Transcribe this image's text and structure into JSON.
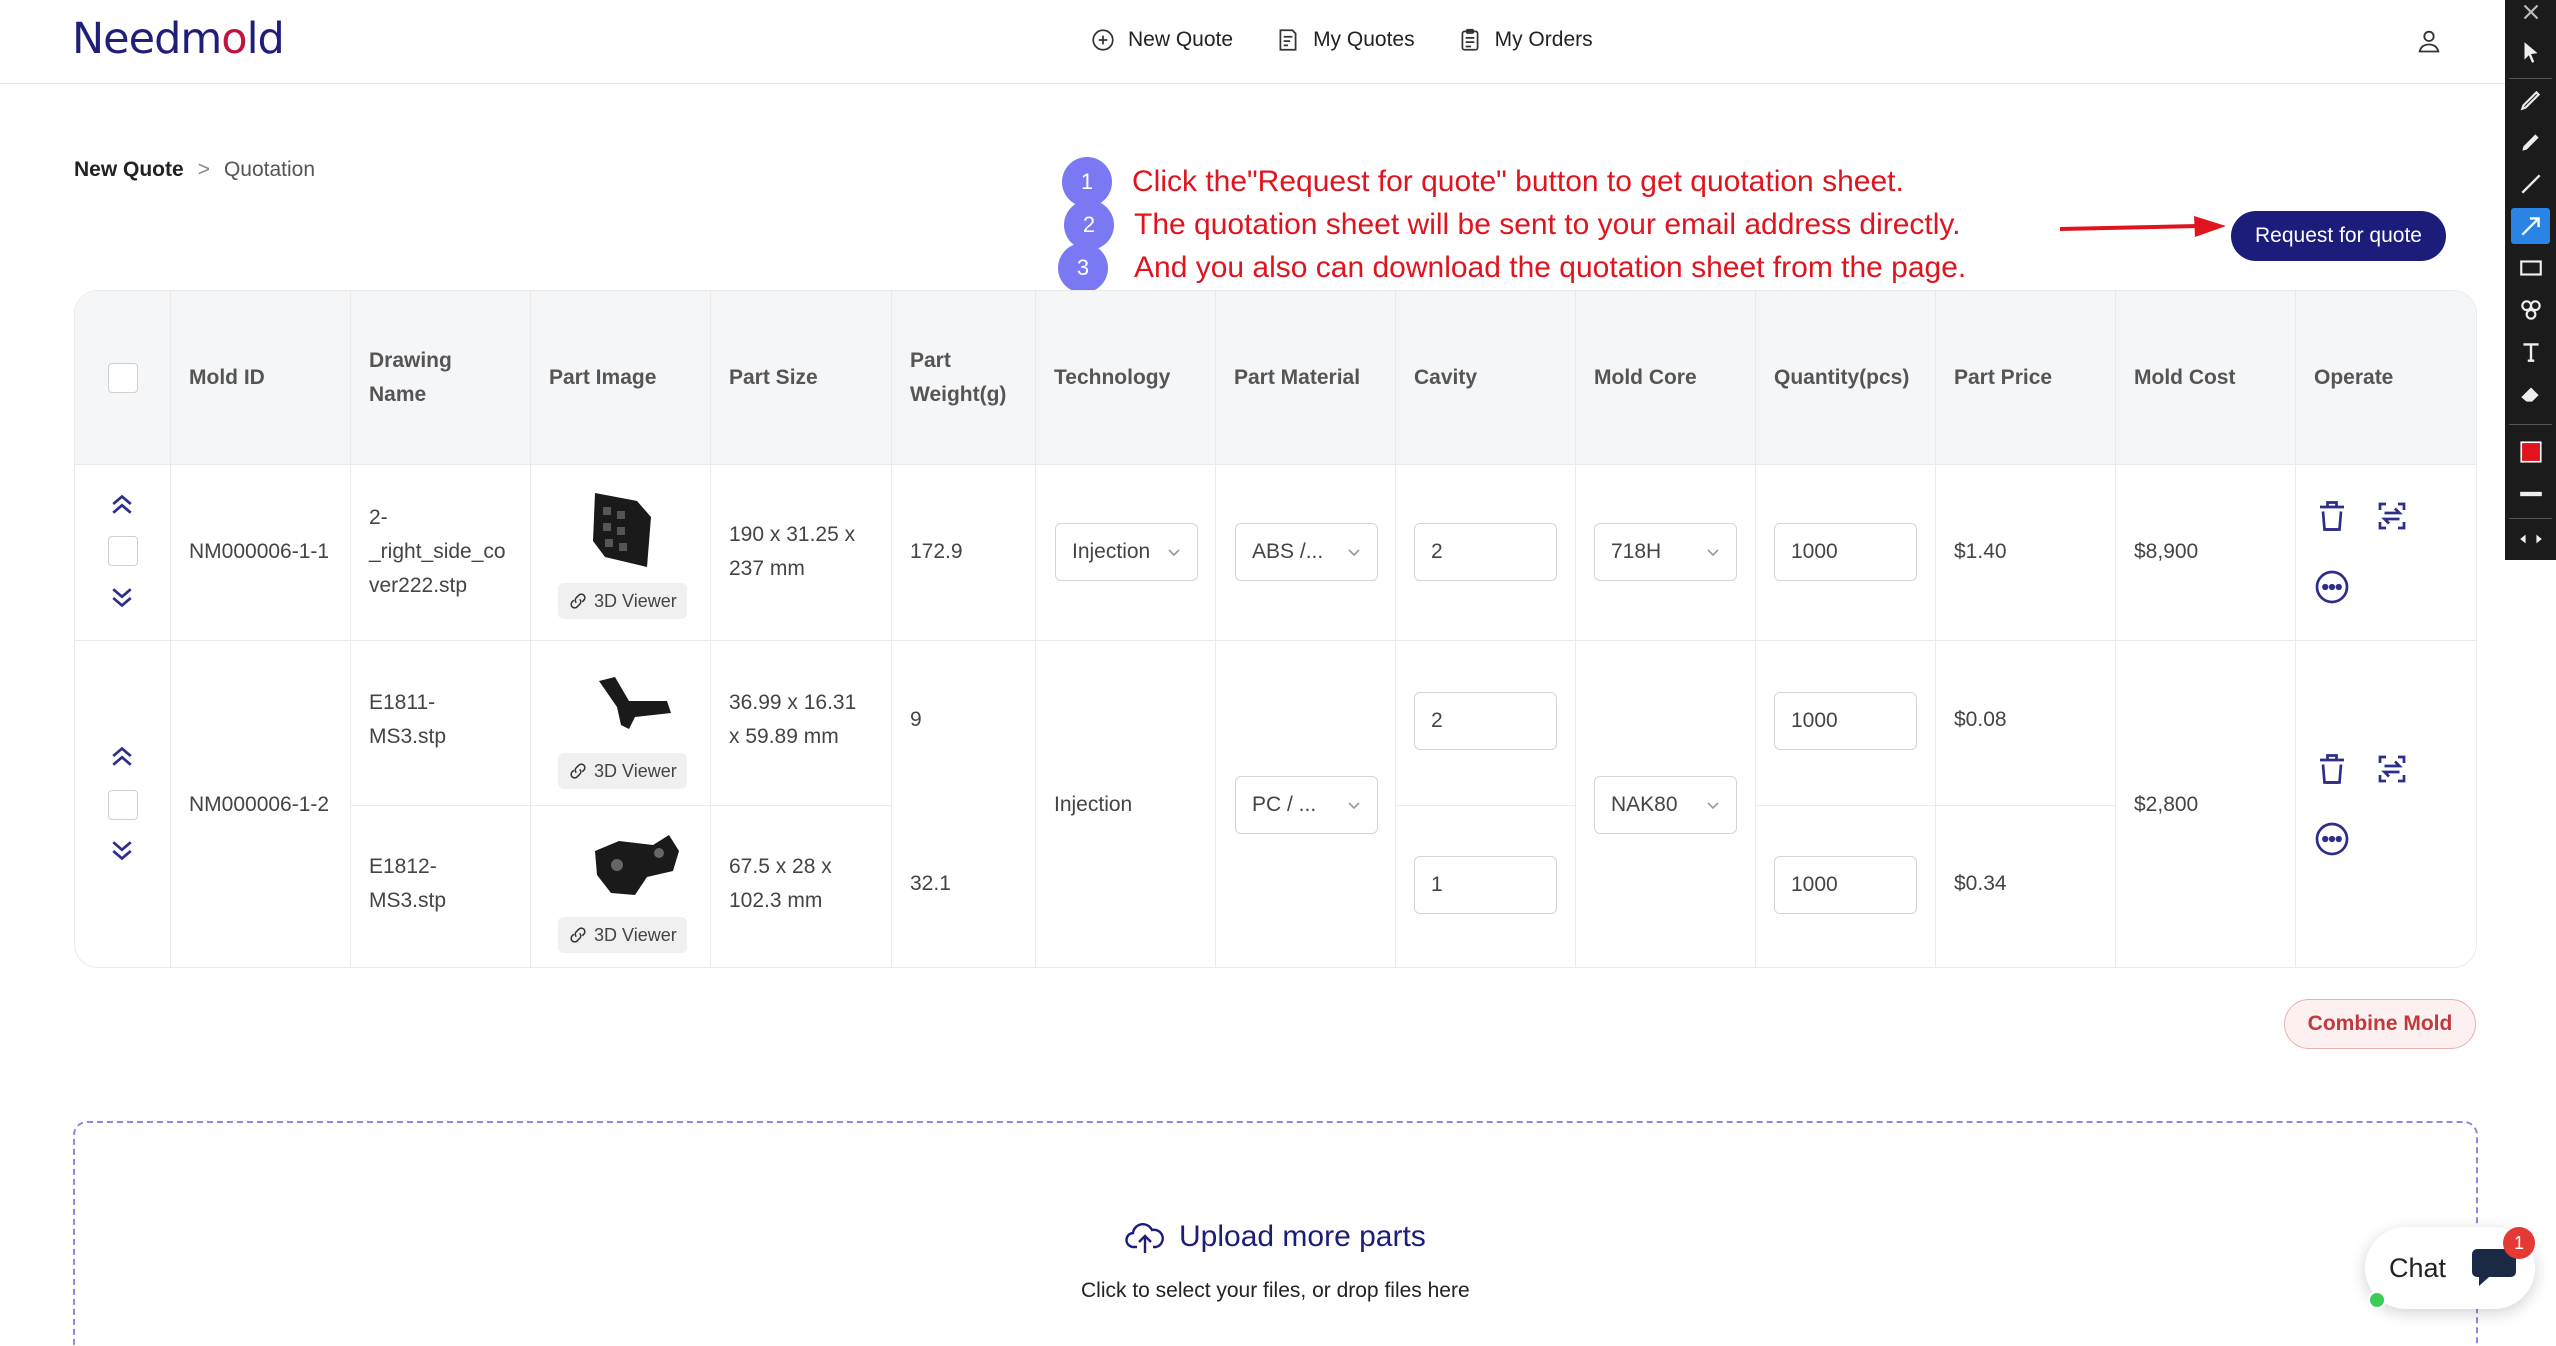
{
  "header": {
    "logo": "Needmold",
    "nav": [
      {
        "label": "New Quote",
        "icon": "plus-circle-icon"
      },
      {
        "label": "My Quotes",
        "icon": "quote-doc-icon"
      },
      {
        "label": "My Orders",
        "icon": "clipboard-icon"
      }
    ],
    "user_icon": "user-icon"
  },
  "breadcrumb": {
    "current": "New Quote",
    "separator": ">",
    "page": "Quotation"
  },
  "annotations": [
    {
      "num": "1",
      "text": "Click the\"Request for quote\" button to get quotation sheet."
    },
    {
      "num": "2",
      "text": "The quotation sheet will be sent to your email address directly."
    },
    {
      "num": "3",
      "text": "And you also can download the quotation sheet from the page."
    }
  ],
  "request_button": "Request for quote",
  "table": {
    "headers": {
      "mold_id": "Mold ID",
      "drawing_name_1": "Drawing",
      "drawing_name_2": "Name",
      "part_image": "Part Image",
      "part_size": "Part Size",
      "part_weight_1": "Part",
      "part_weight_2": "Weight(g)",
      "technology": "Technology",
      "part_material": "Part Material",
      "cavity": "Cavity",
      "mold_core": "Mold Core",
      "quantity": "Quantity(pcs)",
      "part_price": "Part Price",
      "mold_cost": "Mold Cost",
      "operate": "Operate"
    },
    "viewer_label": "3D Viewer",
    "rows": [
      {
        "mold_id": "NM000006-1-1",
        "drawing_1": "2-",
        "drawing_2": "_right_side_co",
        "drawing_3": "ver222.stp",
        "size_1": "190 x 31.25 x",
        "size_2": "237 mm",
        "weight": "172.9",
        "technology": "Injection",
        "material": "ABS /...",
        "cavity": "2",
        "core": "718H",
        "quantity": "1000",
        "price": "$1.40",
        "mold_cost": "$8,900"
      },
      {
        "mold_id": "NM000006-1-2",
        "technology": "Injection",
        "material": "PC / ...",
        "core": "NAK80",
        "mold_cost": "$2,800",
        "parts": [
          {
            "drawing_1": "E1811-",
            "drawing_2": "MS3.stp",
            "size_1": "36.99 x 16.31",
            "size_2": "x 59.89 mm",
            "weight": "9",
            "cavity": "2",
            "quantity": "1000",
            "price": "$0.08"
          },
          {
            "drawing_1": "E1812-",
            "drawing_2": "MS3.stp",
            "size_1": "67.5 x 28 x",
            "size_2": "102.3 mm",
            "weight": "32.1",
            "cavity": "1",
            "quantity": "1000",
            "price": "$0.34"
          }
        ]
      }
    ]
  },
  "combine_button": "Combine Mold",
  "upload": {
    "title": "Upload more parts",
    "subtitle": "Click to select your files, or drop files here"
  },
  "chat": {
    "label": "Chat",
    "badge": "1"
  },
  "colors": {
    "brand": "#1c1c7a",
    "annotation": "#e0141e",
    "accent_circle": "#7a78f2",
    "combine": "#c0393d"
  }
}
